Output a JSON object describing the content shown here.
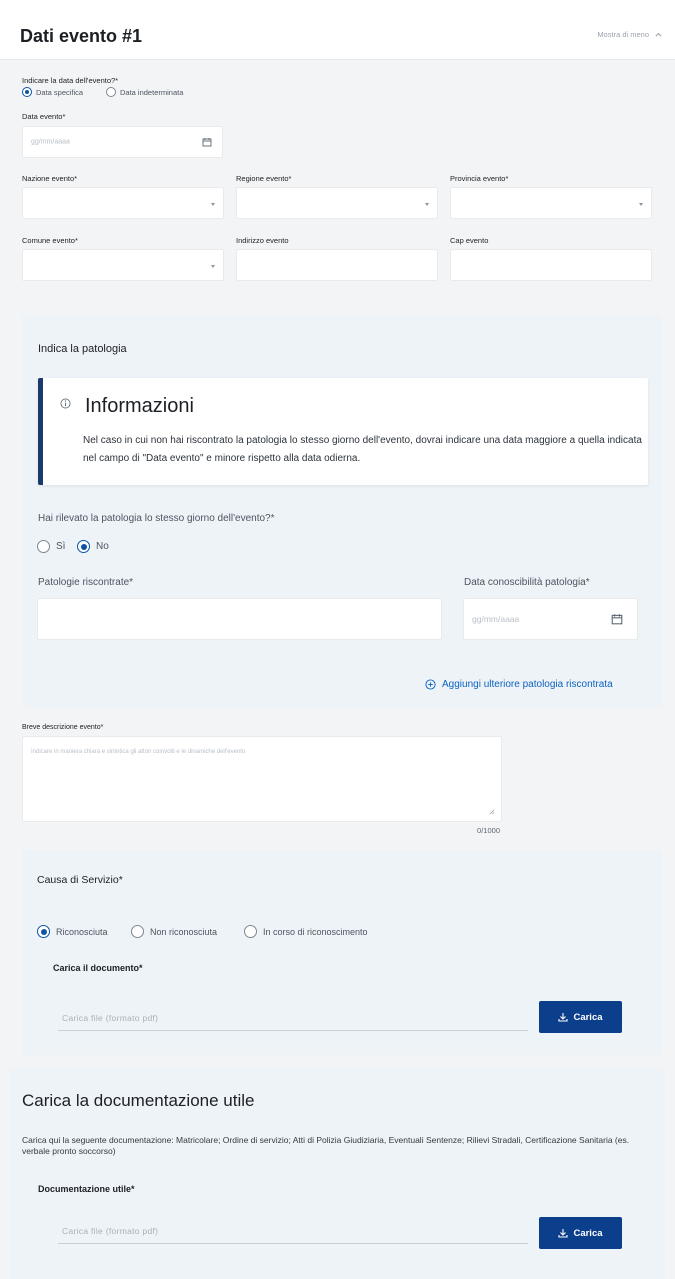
{
  "header": {
    "title": "Dati evento #1",
    "toggle_label": "Mostra di meno",
    "toggle_icon": "chevron-up-icon"
  },
  "event_date": {
    "question": "Indicare la data dell'evento?*",
    "options": [
      {
        "label": "Data specifica",
        "selected": true
      },
      {
        "label": "Data indeterminata",
        "selected": false
      }
    ],
    "date_label": "Data evento*",
    "date_placeholder": "gg/mm/aaaa"
  },
  "location": {
    "nation_label": "Nazione evento*",
    "region_label": "Regione evento*",
    "province_label": "Provincia evento*",
    "city_label": "Comune evento*",
    "address_label": "Indirizzo evento",
    "zip_label": "Cap evento"
  },
  "pathology": {
    "title": "Indica la patologia",
    "info_title": "Informazioni",
    "info_text": "Nel caso in cui non hai riscontrato la patologia lo stesso giorno dell'evento, dovrai indicare una data maggiore a quella indicata nel campo di \"Data evento\" e minore rispetto alla data odierna.",
    "same_day_question": "Hai rilevato la patologia lo stesso giorno dell'evento?*",
    "options": [
      {
        "label": "Sì",
        "selected": false
      },
      {
        "label": "No",
        "selected": true
      }
    ],
    "found_label": "Patologie riscontrate*",
    "known_date_label": "Data conoscibilità patologia*",
    "known_date_placeholder": "gg/mm/aaaa",
    "add_link": "Aggiungi ulteriore patologia riscontrata"
  },
  "description": {
    "label": "Breve descrizione evento*",
    "placeholder": "Indicare in maniera chiara e sintetica gli attori coinvolti e le dinamiche dell'evento",
    "counter": "0/1000"
  },
  "service_cause": {
    "title": "Causa di Servizio*",
    "options": [
      {
        "label": "Riconosciuta",
        "selected": true
      },
      {
        "label": "Non riconosciuta",
        "selected": false
      },
      {
        "label": "In corso di riconoscimento",
        "selected": false
      }
    ],
    "upload_label": "Carica il documento*",
    "upload_placeholder": "Carica file (formato pdf)",
    "upload_button": "Carica"
  },
  "documentation": {
    "title": "Carica la documentazione utile",
    "description": "Carica qui la seguente documentazione: Matricolare; Ordine di servizio; Atti di Polizia Giudiziaria, Eventuali Sentenze; Rilievi Stradali, Certificazione Sanitaria (es. verbale pronto soccorso)",
    "upload_label": "Documentazione utile*",
    "upload_placeholder": "Carica file (formato pdf)",
    "upload_button": "Carica"
  },
  "colors": {
    "primary": "#0b3f8c",
    "link": "#0b62c2",
    "panel": "#eef3f8",
    "info_border": "#1a3a6e"
  }
}
